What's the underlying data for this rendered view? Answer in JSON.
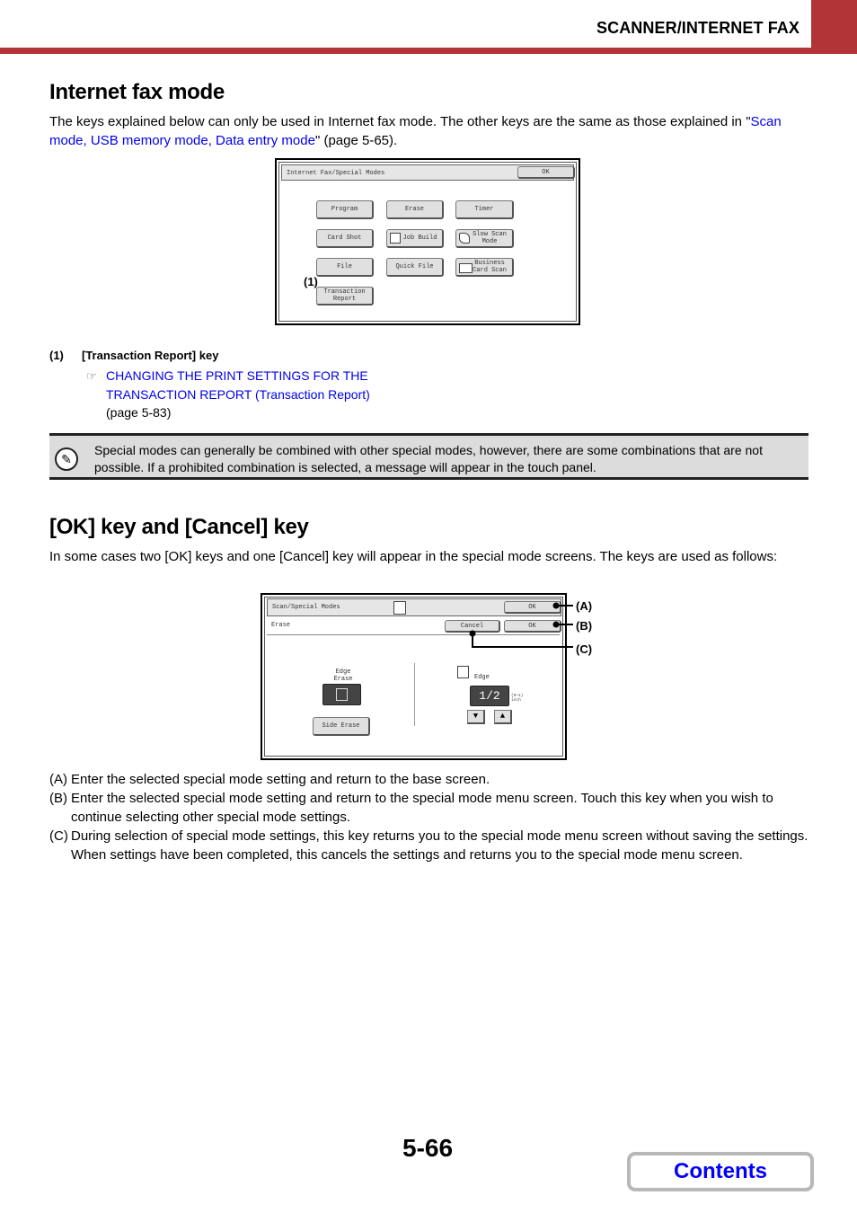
{
  "header": {
    "section_title": "SCANNER/INTERNET FAX",
    "accent_color": "#b33437"
  },
  "section1": {
    "title": "Internet fax mode",
    "intro_prefix": "The keys explained below can only be used in Internet fax mode. The other keys are the same as those explained in \"",
    "intro_link": "Scan mode, USB memory mode, Data entry mode",
    "intro_suffix": "\" (page 5-65).",
    "screen": {
      "title": "Internet Fax/Special Modes",
      "ok_label": "OK",
      "keys": [
        {
          "label": "Program",
          "icon": null
        },
        {
          "label": "Erase",
          "icon": null
        },
        {
          "label": "Timer",
          "icon": null
        },
        {
          "label": "Card Shot",
          "icon": null
        },
        {
          "label": "Job Build",
          "icon": "job-build-icon"
        },
        {
          "label": "Slow Scan Mode",
          "icon": "slow-scan-icon"
        },
        {
          "label": "File",
          "icon": null
        },
        {
          "label": "Quick File",
          "icon": null
        },
        {
          "label": "Business Card Scan",
          "icon": "business-card-icon"
        },
        {
          "label": "Transaction Report",
          "icon": null
        }
      ],
      "callout": "(1)"
    },
    "reference": {
      "number": "(1)",
      "heading": "[Transaction Report] key",
      "link_line1": "CHANGING THE PRINT SETTINGS FOR THE",
      "link_line2": "TRANSACTION REPORT (Transaction Report)",
      "page_ref": "(page 5-83)",
      "icon": "pointing-hand-icon"
    }
  },
  "note": {
    "icon": "pencil-note-icon",
    "text": "Special modes can generally be combined with other special modes, however, there are some combinations that are not possible. If a prohibited combination is selected, a message will appear in the touch panel."
  },
  "section2": {
    "title": "[OK] key and [Cancel] key",
    "intro": "In some cases two [OK] keys and one [Cancel] key will appear in the special mode screens. The keys are used as follows:",
    "screen": {
      "title": "Scan/Special Modes",
      "ok_label": "OK",
      "sub_title": "Erase",
      "cancel_label": "Cancel",
      "sub_ok_label": "OK",
      "edge_erase_label": "Edge Erase",
      "side_erase_label": "Side Erase",
      "edge_label": "Edge",
      "edge_value": "1/2",
      "range": "(0~1)",
      "unit": "inch",
      "callouts": [
        "(A)",
        "(B)",
        "(C)"
      ]
    },
    "list": [
      {
        "marker": "(A)",
        "text": "Enter the selected special mode setting and return to the base screen."
      },
      {
        "marker": "(B)",
        "text": "Enter the selected special mode setting and return to the special mode menu screen. Touch this key when you wish to continue selecting other special mode settings."
      },
      {
        "marker": "(C)",
        "text": "During selection of special mode settings, this key returns you to the special mode menu screen without saving the settings. When settings have been completed, this cancels the settings and returns you to the special mode menu screen."
      }
    ]
  },
  "footer": {
    "page_number": "5-66",
    "contents_label": "Contents"
  }
}
